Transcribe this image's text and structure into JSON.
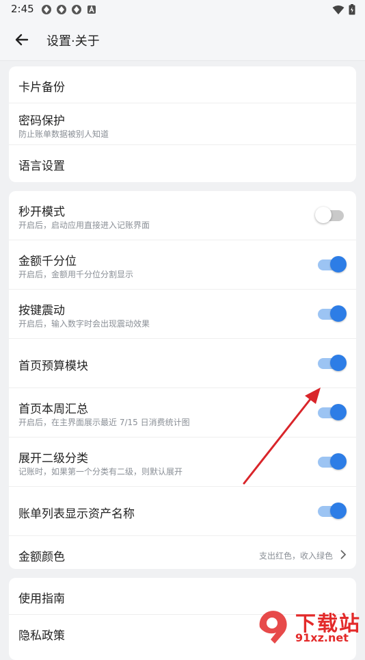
{
  "status_bar": {
    "time": "2:45"
  },
  "header": {
    "title": "设置·关于"
  },
  "card1": {
    "items": [
      {
        "title": "卡片备份"
      },
      {
        "title": "密码保护",
        "subtitle": "防止账单数据被别人知道"
      },
      {
        "title": "语言设置"
      }
    ]
  },
  "card2": {
    "items": [
      {
        "title": "秒开模式",
        "subtitle": "开启后，启动应用直接进入记账界面",
        "toggle": false
      },
      {
        "title": "金额千分位",
        "subtitle": "开启后，金额用千分位分割显示",
        "toggle": true
      },
      {
        "title": "按键震动",
        "subtitle": "开启后，输入数字时会出现震动效果",
        "toggle": true
      },
      {
        "title": "首页预算模块",
        "toggle": true
      },
      {
        "title": "首页本周汇总",
        "subtitle": "开启后，在主界面展示最近 7/15 日消费统计图",
        "toggle": true
      },
      {
        "title": "展开二级分类",
        "subtitle": "记账时，如果第一个分类有二级，则默认展开",
        "toggle": true
      },
      {
        "title": "账单列表显示资产名称",
        "toggle": true
      },
      {
        "title": "金额颜色",
        "value": "支出红色，收入绿色"
      }
    ]
  },
  "card3": {
    "items": [
      {
        "title": "使用指南"
      },
      {
        "title": "隐私政策"
      }
    ]
  },
  "watermark": {
    "line1": "下载站",
    "line2": "91xz.net"
  },
  "colors": {
    "accent": "#2d7de6",
    "arrow": "#d9252a"
  }
}
